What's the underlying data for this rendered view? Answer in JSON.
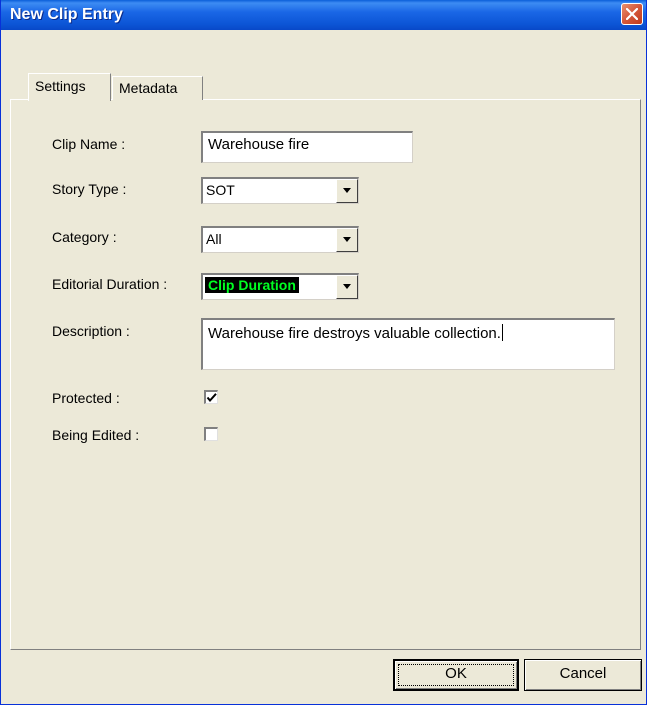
{
  "window": {
    "title": "New Clip Entry"
  },
  "tabs": [
    {
      "label": "Settings",
      "active": true
    },
    {
      "label": "Metadata",
      "active": false
    }
  ],
  "form": {
    "clip_name": {
      "label": "Clip Name :",
      "value": "Warehouse fire"
    },
    "story_type": {
      "label": "Story Type :",
      "value": "SOT"
    },
    "category": {
      "label": "Category :",
      "value": "All"
    },
    "editorial_duration": {
      "label": "Editorial Duration :",
      "value": "Clip Duration",
      "highlight_text_color": "#00ff22",
      "highlight_bg_color": "#000000"
    },
    "description": {
      "label": "Description :",
      "value": "Warehouse fire destroys valuable collection."
    },
    "protected": {
      "label": "Protected :",
      "checked": true
    },
    "being_edited": {
      "label": "Being Edited :",
      "checked": false
    }
  },
  "buttons": {
    "ok": "OK",
    "cancel": "Cancel"
  },
  "colors": {
    "titlebar": "#0c55d6",
    "dialog_bg": "#ece9d8",
    "close_button": "#d4573a"
  }
}
